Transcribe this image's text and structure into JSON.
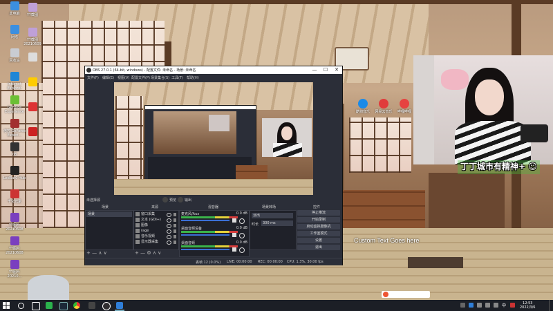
{
  "desktop_icons": [
    {
      "label": "此电脑",
      "color": "#3b8fe0"
    },
    {
      "label": "网络",
      "color": "#3b8fe0"
    },
    {
      "label": "回收站",
      "color": "#c9ccd2"
    },
    {
      "label": "Internet Explorer",
      "color": "#1e86d6"
    },
    {
      "label": "GeForce Experience",
      "color": "#6bbf34"
    },
    {
      "label": "倍控 GeForce Experi...",
      "color": "#a23030"
    },
    {
      "label": "08",
      "color": "#333333"
    },
    {
      "label": "LedBat0 Hub",
      "color": "#222222"
    },
    {
      "label": "千仑元素",
      "color": "#cc3333"
    },
    {
      "label": "YY图片 20210608",
      "color": "#7a3fbf"
    },
    {
      "label": "YY图片 20210608",
      "color": "#7a3fbf"
    },
    {
      "label": "YY图片 20210...",
      "color": "#7a3fbf"
    }
  ],
  "desktop_icons_col2": [
    {
      "label": "YY截图",
      "color": "#bfa0d8"
    },
    {
      "label": "YY截图 20210609",
      "color": "#bfa0d8"
    },
    {
      "label": "",
      "color": "#dddddd"
    },
    {
      "label": "",
      "color": "#ffcc00"
    },
    {
      "label": "",
      "color": "#dd3333"
    },
    {
      "label": "",
      "color": "#cc2222"
    }
  ],
  "wallpaper_shortcuts": [
    {
      "label": "酷狗音乐",
      "color": "#1a8ae8"
    },
    {
      "label": "网易云音乐",
      "color": "#e13b3b"
    },
    {
      "label": "哔哩哔哩",
      "color": "#e64340"
    }
  ],
  "webcam": {
    "overlay_text": "丁丁城市有精神+ ☺",
    "custom_text": "Custom Text Goes here"
  },
  "obs": {
    "title": "OBS 27.0.1 (64-bit, windows) - 配置文件: 未命名 - 场景: 未命名",
    "minimize_icon": "—",
    "maximize_icon": "☐",
    "close_icon": "✕",
    "menu": [
      "文件(F)",
      "编辑(E)",
      "视图(V)",
      "配置文件(P)",
      "场景集合(S)",
      "工具(T)",
      "帮助(H)"
    ],
    "preview_toggle": [
      "预览",
      "输出"
    ],
    "transition_label": "未选择源",
    "docks": {
      "scenes": {
        "title": "场景",
        "items": [
          "场景"
        ]
      },
      "sources": {
        "title": "来源",
        "items": [
          "窗口采集",
          "文本 (GDI+)",
          "图像",
          "rage",
          "音乐视频",
          "显示器采集"
        ]
      },
      "mixer": {
        "title": "混音器",
        "channels": [
          {
            "name": "麦克风/Aux",
            "db": "0.0 dB"
          },
          {
            "name": "桌面音频设备",
            "db": "0.0 dB"
          },
          {
            "name": "桌面音频",
            "db": "0.0 dB"
          }
        ]
      },
      "transitions": {
        "title": "场景转场",
        "type": "淡出",
        "duration_label": "时长",
        "duration": "300 ms"
      },
      "controls": {
        "title": "控件",
        "buttons": [
          "停止推流",
          "开始录制",
          "启动虚拟摄像机",
          "工作室模式",
          "设置",
          "退出"
        ]
      }
    },
    "status": {
      "live": "LIVE: 00:00:00",
      "rec": "REC: 00:00:00",
      "cpu": "CPU: 1.3%, 30.00 fps",
      "dropped": "丢帧 12 (0.0%)"
    }
  },
  "taskbar": {
    "time": "12:53",
    "date": "2022/3/6",
    "ime_label": "中"
  }
}
